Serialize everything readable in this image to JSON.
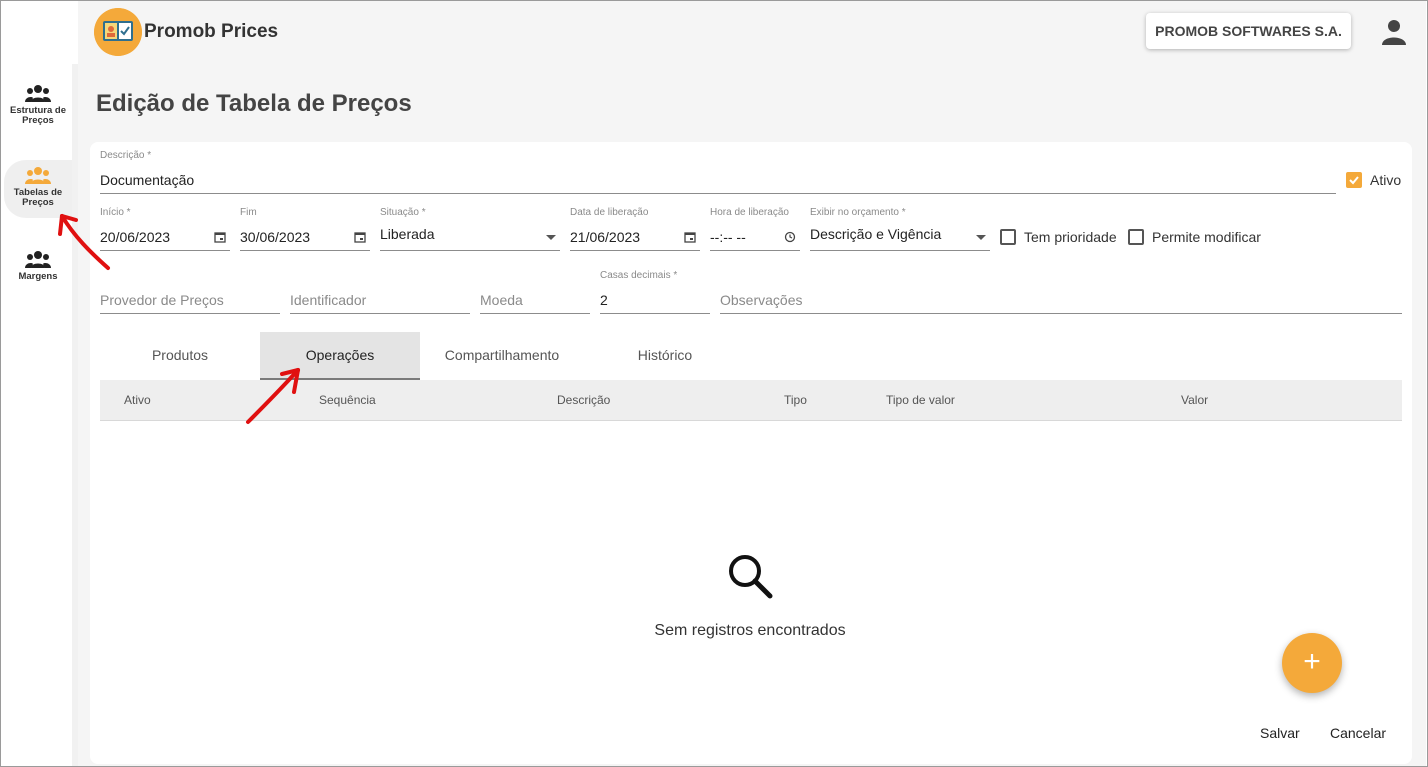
{
  "app": {
    "title": "Promob Prices",
    "company": "PROMOB SOFTWARES S.A.",
    "accent_color": "#f4a93a"
  },
  "sidebar": {
    "items": [
      {
        "label": "Estrutura de Preços",
        "icon": "people-icon"
      },
      {
        "label": "Tabelas de Preços",
        "icon": "people-icon",
        "active": true
      },
      {
        "label": "Margens",
        "icon": "people-icon"
      }
    ]
  },
  "page": {
    "title": "Edição de Tabela de Preços"
  },
  "form": {
    "descricao": {
      "label": "Descrição *",
      "value": "Documentação"
    },
    "ativo": {
      "label": "Ativo",
      "checked": true
    },
    "inicio": {
      "label": "Início *",
      "value": "20/06/2023"
    },
    "fim": {
      "label": "Fim",
      "value": "30/06/2023"
    },
    "situacao": {
      "label": "Situação *",
      "value": "Liberada"
    },
    "data_liberacao": {
      "label": "Data de liberação",
      "value": "21/06/2023"
    },
    "hora_liberacao": {
      "label": "Hora de liberação",
      "value": "--:-- --"
    },
    "exibir_orcamento": {
      "label": "Exibir no orçamento *",
      "value": "Descrição e Vigência"
    },
    "tem_prioridade": {
      "label": "Tem prioridade",
      "checked": false
    },
    "permite_modificar": {
      "label": "Permite modificar",
      "checked": false
    },
    "provedor": {
      "placeholder": "Provedor de Preços"
    },
    "identificador": {
      "placeholder": "Identificador"
    },
    "moeda": {
      "placeholder": "Moeda"
    },
    "casas_decimais": {
      "label": "Casas decimais *",
      "value": "2"
    },
    "observacoes": {
      "placeholder": "Observações"
    }
  },
  "tabs": [
    {
      "label": "Produtos"
    },
    {
      "label": "Operações",
      "active": true
    },
    {
      "label": "Compartilhamento"
    },
    {
      "label": "Histórico"
    }
  ],
  "table": {
    "columns": [
      "Ativo",
      "Sequência",
      "Descrição",
      "Tipo",
      "Tipo de valor",
      "Valor"
    ],
    "rows": [],
    "empty_message": "Sem registros encontrados",
    "empty_icon": "search-icon"
  },
  "actions": {
    "add_label": "+",
    "save_label": "Salvar",
    "cancel_label": "Cancelar"
  }
}
